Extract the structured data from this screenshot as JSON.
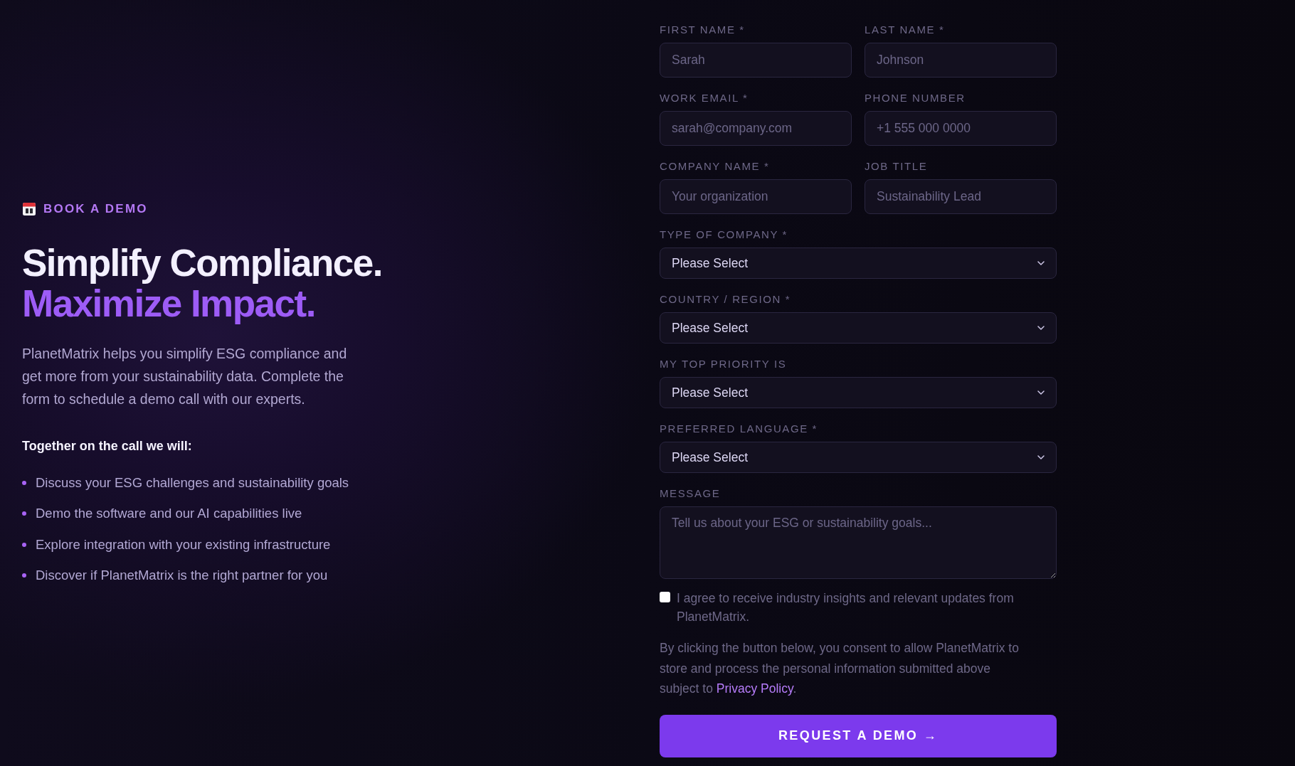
{
  "intro": {
    "eyebrow": "BOOK A DEMO",
    "headline": {
      "text": "Simplify Compliance.",
      "highlight": "Maximize Impact."
    },
    "description": "PlanetMatrix helps you simplify ESG compliance and get more from your sustainability data. Complete the form to schedule a demo call with our experts.",
    "agenda_heading": "Together on the call we will:",
    "agenda_items": [
      "Discuss your ESG challenges and sustainability goals",
      "Demo the software and our AI capabilities live",
      "Explore integration with your existing infrastructure",
      "Discover if PlanetMatrix is the right partner for you"
    ]
  },
  "form": {
    "fields": [
      {
        "kind": "text",
        "label": "FIRST NAME *",
        "placeholder": "Sarah"
      },
      {
        "kind": "text",
        "label": "LAST NAME *",
        "placeholder": "Johnson"
      },
      {
        "kind": "text",
        "label": "WORK EMAIL *",
        "placeholder": "sarah@company.com"
      },
      {
        "kind": "text",
        "label": "PHONE NUMBER",
        "placeholder": "+1 555 000 0000"
      },
      {
        "kind": "text",
        "label": "COMPANY NAME *",
        "placeholder": "Your organization"
      },
      {
        "kind": "text",
        "label": "JOB TITLE",
        "placeholder": "Sustainability Lead"
      },
      {
        "kind": "select",
        "label": "TYPE OF COMPANY *",
        "value": "Please Select"
      },
      {
        "kind": "select",
        "label": "COUNTRY / REGION *",
        "value": "Please Select"
      },
      {
        "kind": "select",
        "label": "MY TOP PRIORITY IS",
        "value": "Please Select"
      },
      {
        "kind": "select",
        "label": "PREFERRED LANGUAGE *",
        "value": "Please Select"
      },
      {
        "kind": "textarea",
        "label": "MESSAGE",
        "placeholder": "Tell us about your ESG or sustainability goals..."
      }
    ],
    "consent": {
      "checked": false,
      "label": "I agree to receive industry insights and relevant updates from PlanetMatrix."
    },
    "notice": {
      "text": "By clicking the button below, you consent to allow PlanetMatrix to store and process the personal information submitted above subject to ",
      "link": "Privacy Policy",
      "after": "."
    },
    "submit_button": "REQUEST A DEMO →"
  }
}
